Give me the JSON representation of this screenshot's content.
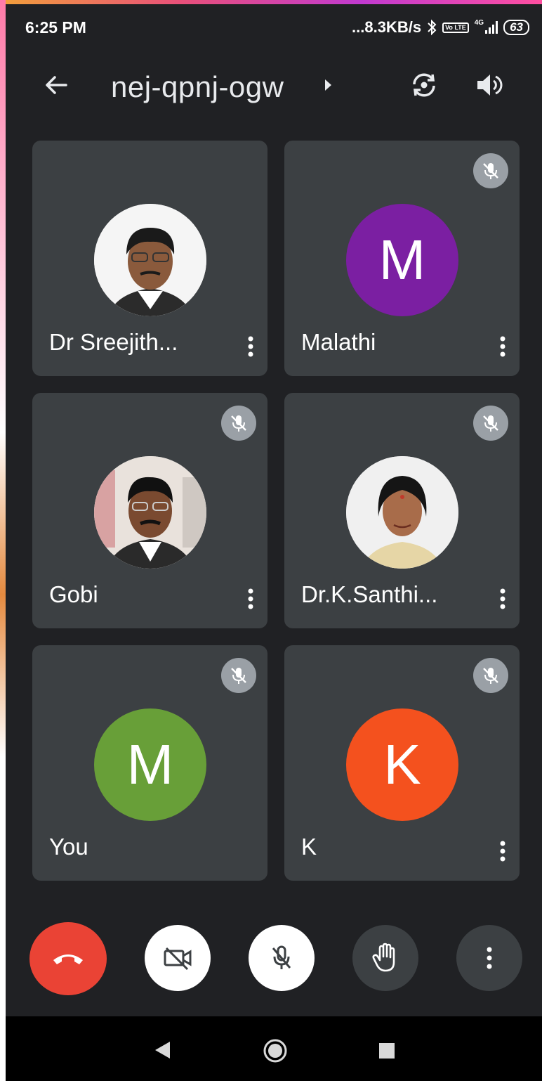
{
  "status_bar": {
    "time": "6:25 PM",
    "net_speed": "...8.3KB/s",
    "bluetooth_icon": "bluetooth-icon",
    "volte_label": "Vo LTE",
    "network_label": "4G",
    "battery_level": "63"
  },
  "header": {
    "meeting_code": "nej-qpnj-ogw",
    "back_icon": "arrow-back-icon",
    "switch_camera_icon": "switch-camera-icon",
    "speaker_icon": "volume-icon"
  },
  "participants": [
    {
      "name": "Dr Sreejith...",
      "avatar_type": "photo",
      "muted": false
    },
    {
      "name": "Malathi",
      "avatar_type": "initial",
      "initial": "M",
      "color": "#7b1fa2",
      "muted": true
    },
    {
      "name": "Gobi",
      "avatar_type": "photo",
      "muted": true
    },
    {
      "name": "Dr.K.Santhi...",
      "avatar_type": "photo",
      "muted": true
    },
    {
      "name": "You",
      "avatar_type": "initial",
      "initial": "M",
      "color": "#689f38",
      "muted": true
    },
    {
      "name": "K",
      "avatar_type": "initial",
      "initial": "K",
      "color": "#f4511e",
      "muted": true
    }
  ],
  "controls": {
    "end_call_color": "#ea4335",
    "end_call_icon": "end-call-icon",
    "camera_icon": "camera-off-icon",
    "mic_icon": "mic-off-icon",
    "raise_hand_icon": "raise-hand-icon",
    "more_icon": "more-vert-icon"
  },
  "nav_bar": {
    "back_icon": "nav-back-icon",
    "home_icon": "nav-home-icon",
    "recents_icon": "nav-recents-icon"
  }
}
